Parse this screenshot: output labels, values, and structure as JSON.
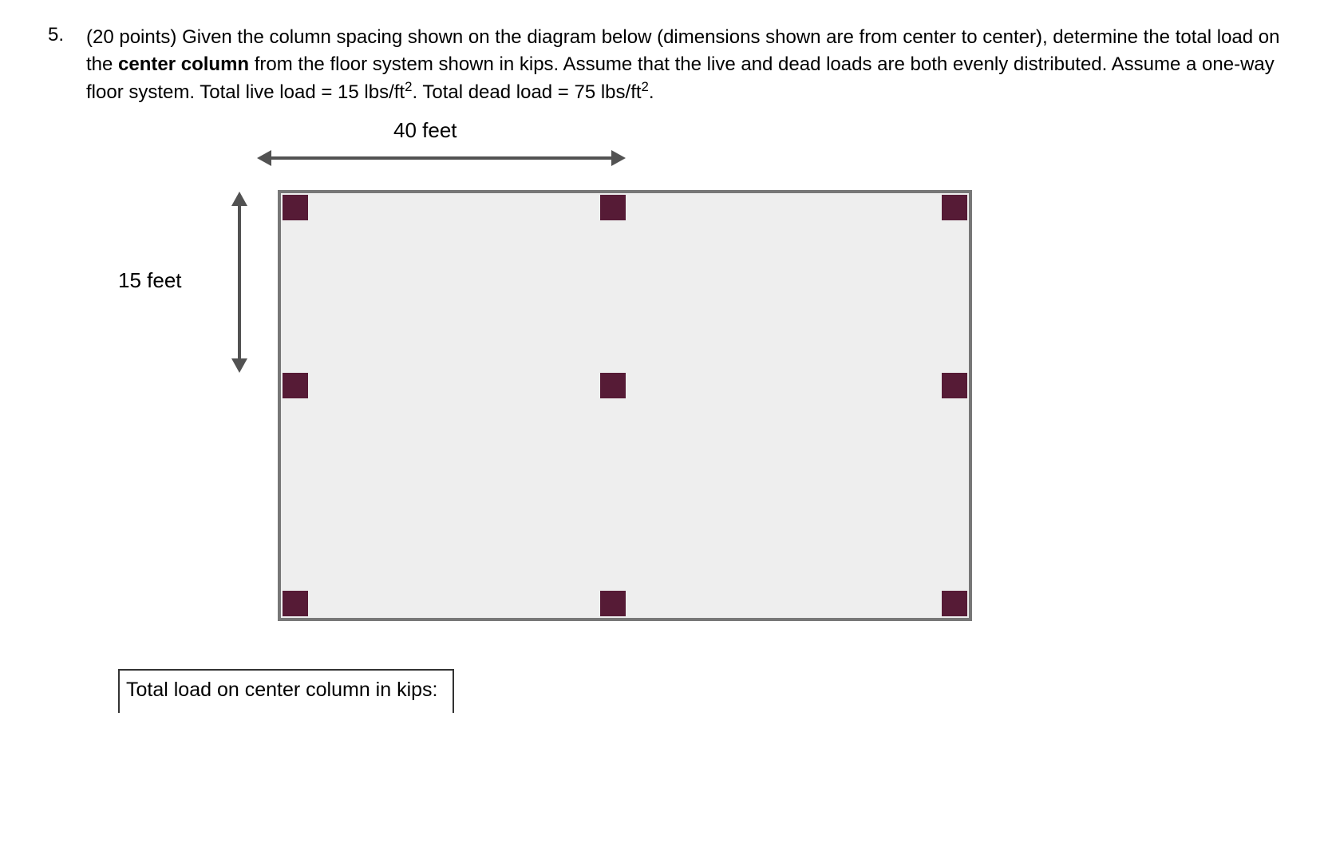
{
  "question": {
    "number": "5.",
    "points_prefix": "(20 points) ",
    "text_part1": "Given the column spacing shown on the diagram below (dimensions shown are from center to center), determine the total load on the ",
    "bold_text": "center column",
    "text_part2": " from the floor system shown in kips. Assume that the live and dead loads are both evenly distributed. Assume a one-way floor system. Total live load = 15 lbs/ft",
    "text_part3": ". Total dead load = 75 lbs/ft",
    "text_part4": ".",
    "superscript": "2"
  },
  "diagram": {
    "dim_horizontal": "40 feet",
    "dim_vertical": "15 feet",
    "column_spacing_x_ft": 40,
    "column_spacing_y_ft": 15,
    "grid_rows": 3,
    "grid_cols": 3,
    "loads": {
      "live_load_psf": 15,
      "dead_load_psf": 75
    }
  },
  "answer_box_label": "Total load on center column in kips:"
}
